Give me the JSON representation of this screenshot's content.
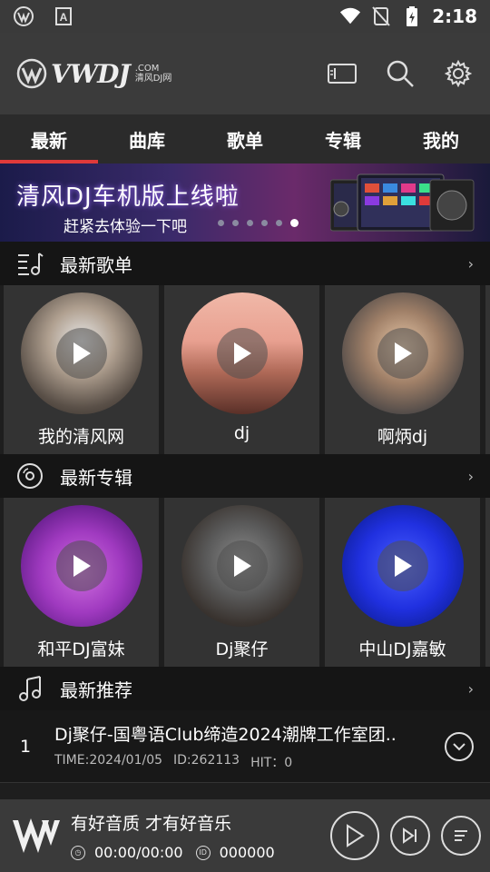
{
  "status_bar": {
    "time": "2:18",
    "left_icons": [
      "vwdj-notification-icon",
      "accessibility-a-icon"
    ],
    "right_icons": [
      "wifi-icon",
      "no-sim-icon",
      "battery-charging-icon"
    ]
  },
  "app_bar": {
    "logo_text": "VWDJ",
    "logo_domain": ".COM",
    "logo_sub": "清风DJ网",
    "actions": [
      "cast-screen-icon",
      "search-icon",
      "settings-gear-icon"
    ]
  },
  "tabs": [
    {
      "label": "最新",
      "active": true
    },
    {
      "label": "曲库",
      "active": false
    },
    {
      "label": "歌单",
      "active": false
    },
    {
      "label": "专辑",
      "active": false
    },
    {
      "label": "我的",
      "active": false
    }
  ],
  "banner": {
    "title": "清风DJ车机版上线啦",
    "subtitle": "赶紧去体验一下吧",
    "dot_count": 6,
    "active_dot": 6
  },
  "sections": {
    "playlists": {
      "title": "最新歌单",
      "more": "›",
      "items": [
        {
          "label": "我的清风网"
        },
        {
          "label": "dj"
        },
        {
          "label": "啊炳dj"
        }
      ]
    },
    "albums": {
      "title": "最新专辑",
      "more": "›",
      "items": [
        {
          "label": "和平DJ富妹"
        },
        {
          "label": "Dj聚仔"
        },
        {
          "label": "中山DJ嘉敏"
        }
      ]
    },
    "recommend": {
      "title": "最新推荐",
      "more": "›",
      "songs": [
        {
          "num": "1",
          "title": "Dj聚仔-国粤语Club缔造2024潮牌工作室团..",
          "time": "TIME:2024/01/05",
          "id": "ID:262113",
          "hit": "HIT：0"
        }
      ]
    }
  },
  "player": {
    "title": "有好音质 才有好音乐",
    "time": "00:00/00:00",
    "id": "000000"
  },
  "colors": {
    "accent": "#e03a3a",
    "status_bg": "#3a3a3a",
    "card_bg": "#333333"
  }
}
